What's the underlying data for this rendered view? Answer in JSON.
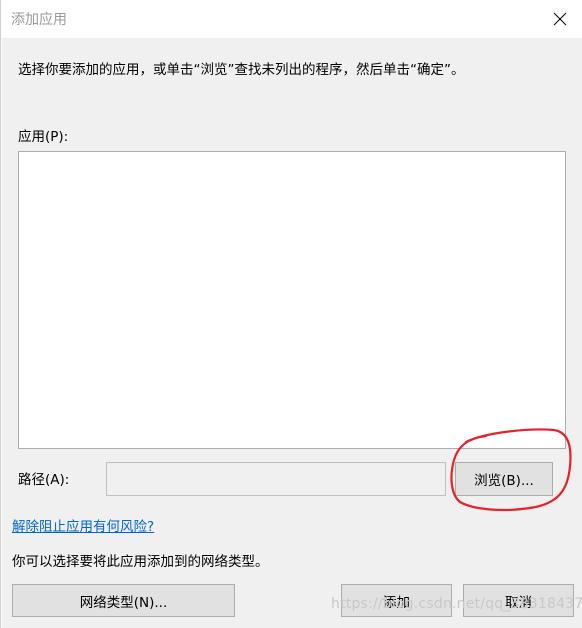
{
  "window": {
    "title": "添加应用",
    "close_icon": "close-icon"
  },
  "dialog": {
    "description": "选择你要添加的应用，或单击“浏览”查找未列出的程序，然后单击“确定”。",
    "app_list_label": "应用(P):",
    "path_label": "路径(A):",
    "path_value": "",
    "browse_label": "浏览(B)...",
    "risk_link": "解除阻止应用有何风险?",
    "network_desc": "你可以选择要将此应用添加到的网络类型。",
    "network_type_label": "网络类型(N)...",
    "add_label": "添加",
    "cancel_label": "取消"
  },
  "overlay": {
    "watermark": "https://blog.csdn.net/qq_38318437",
    "annotation_color": "#e8202a"
  }
}
